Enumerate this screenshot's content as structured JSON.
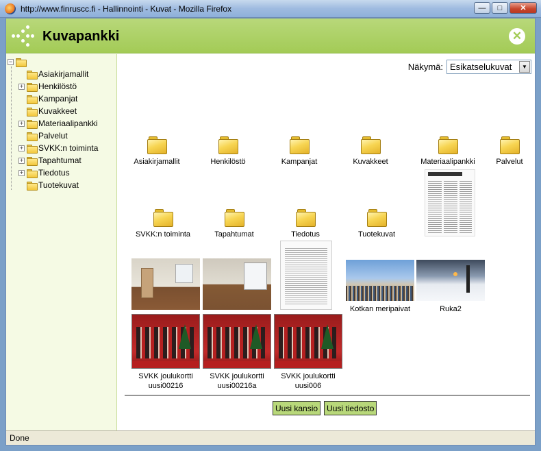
{
  "window": {
    "title": "http://www.finruscc.fi - Hallinnointi - Kuvat - Mozilla Firefox",
    "minimize_glyph": "—",
    "maximize_glyph": "□",
    "close_glyph": "✕"
  },
  "header": {
    "app_title": "Kuvapankki",
    "close_glyph": "✕",
    "accent_color": "#a3cb56"
  },
  "sidebar": {
    "items": [
      {
        "label": "Asiakirjamallit",
        "expandable": false
      },
      {
        "label": "Henkilöstö",
        "expandable": true
      },
      {
        "label": "Kampanjat",
        "expandable": false
      },
      {
        "label": "Kuvakkeet",
        "expandable": false
      },
      {
        "label": "Materiaalipankki",
        "expandable": true
      },
      {
        "label": "Palvelut",
        "expandable": false
      },
      {
        "label": "SVKK:n toiminta",
        "expandable": true
      },
      {
        "label": "Tapahtumat",
        "expandable": true
      },
      {
        "label": "Tiedotus",
        "expandable": true
      },
      {
        "label": "Tuotekuvat",
        "expandable": false
      }
    ],
    "expander_glyph": "+",
    "root_expander_glyph": "−"
  },
  "view": {
    "label": "Näkymä:",
    "selected": "Esikatselukuvat",
    "arrow_glyph": "▼"
  },
  "folders": [
    {
      "label": "Asiakirjamallit"
    },
    {
      "label": "Henkilöstö"
    },
    {
      "label": "Kampanjat"
    },
    {
      "label": "Kuvakkeet"
    },
    {
      "label": "Materiaalipankki"
    },
    {
      "label": "Palvelut"
    },
    {
      "label": "SVKK:n toiminta"
    },
    {
      "label": "Tapahtumat"
    },
    {
      "label": "Tiedotus"
    },
    {
      "label": "Tuotekuvat"
    }
  ],
  "images": [
    {
      "label": "",
      "kind": "newsprint"
    },
    {
      "label": "",
      "kind": "room"
    },
    {
      "label": "",
      "kind": "room"
    },
    {
      "label": "",
      "kind": "document"
    },
    {
      "label": "Kotkan meripaivat",
      "kind": "harbor"
    },
    {
      "label": "Ruka2",
      "kind": "ski"
    },
    {
      "label_line1": "SVKK joulukortti",
      "label_line2": "uusi00216",
      "kind": "christmas"
    },
    {
      "label_line1": "SVKK joulukortti",
      "label_line2": "uusi00216a",
      "kind": "christmas"
    },
    {
      "label_line1": "SVKK joulukortti",
      "label_line2": "uusi006",
      "kind": "christmas"
    }
  ],
  "actions": {
    "new_folder": "Uusi kansio",
    "new_file": "Uusi tiedosto"
  },
  "status": {
    "text": "Done"
  }
}
